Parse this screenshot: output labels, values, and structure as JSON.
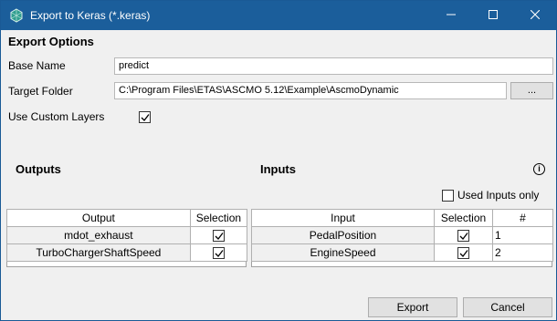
{
  "window": {
    "title": "Export to Keras (*.keras)"
  },
  "export_options": {
    "heading": "Export Options",
    "base_name_label": "Base Name",
    "base_name_value": "predict",
    "target_folder_label": "Target Folder",
    "target_folder_value": "C:\\Program Files\\ETAS\\ASCMO 5.12\\Example\\AscmoDynamic",
    "browse_label": "...",
    "custom_layers_label": "Use Custom Layers",
    "custom_layers_checked": true
  },
  "outputs": {
    "heading": "Outputs",
    "columns": [
      "Output",
      "Selection"
    ],
    "rows": [
      {
        "name": "mdot_exhaust",
        "selected": true
      },
      {
        "name": "TurboChargerShaftSpeed",
        "selected": true
      }
    ]
  },
  "inputs": {
    "heading": "Inputs",
    "used_inputs_only_label": "Used Inputs only",
    "used_inputs_only_checked": false,
    "columns": [
      "Input",
      "Selection",
      "#"
    ],
    "rows": [
      {
        "name": "PedalPosition",
        "selected": true,
        "index": "1"
      },
      {
        "name": "EngineSpeed",
        "selected": true,
        "index": "2"
      }
    ]
  },
  "buttons": {
    "export_label": "Export",
    "cancel_label": "Cancel"
  },
  "icons": {
    "app": "keras-app-icon",
    "info": "info-icon",
    "minimize": "minimize-icon",
    "maximize": "maximize-icon",
    "close": "close-icon"
  },
  "colors": {
    "titlebar": "#1b5e9b",
    "dialog_bg": "#f0f0f0"
  }
}
